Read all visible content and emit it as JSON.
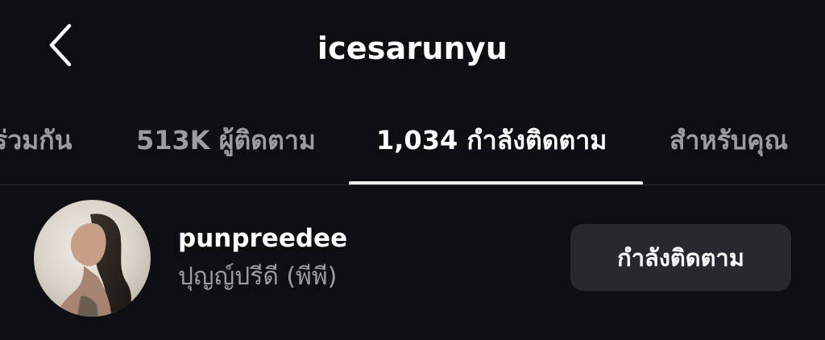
{
  "header": {
    "back_icon": "chevron-left-icon",
    "title": "icesarunyu"
  },
  "tabs": [
    {
      "label": "ร่วมกัน",
      "active": false
    },
    {
      "label": "513K ผู้ติดตาม",
      "active": false
    },
    {
      "label": "1,034 กำลังติดตาม",
      "active": true
    },
    {
      "label": "สำหรับคุณ",
      "active": false
    }
  ],
  "list": {
    "items": [
      {
        "username": "punpreedee",
        "full_name": "ปุญญ์ปรีดี (พีพี)",
        "button_label": "กำลังติดตาม"
      }
    ]
  },
  "colors": {
    "background": "#0d0f12",
    "text_primary": "#ffffff",
    "text_secondary": "#9a9ea4",
    "button_bg": "#26292d"
  }
}
